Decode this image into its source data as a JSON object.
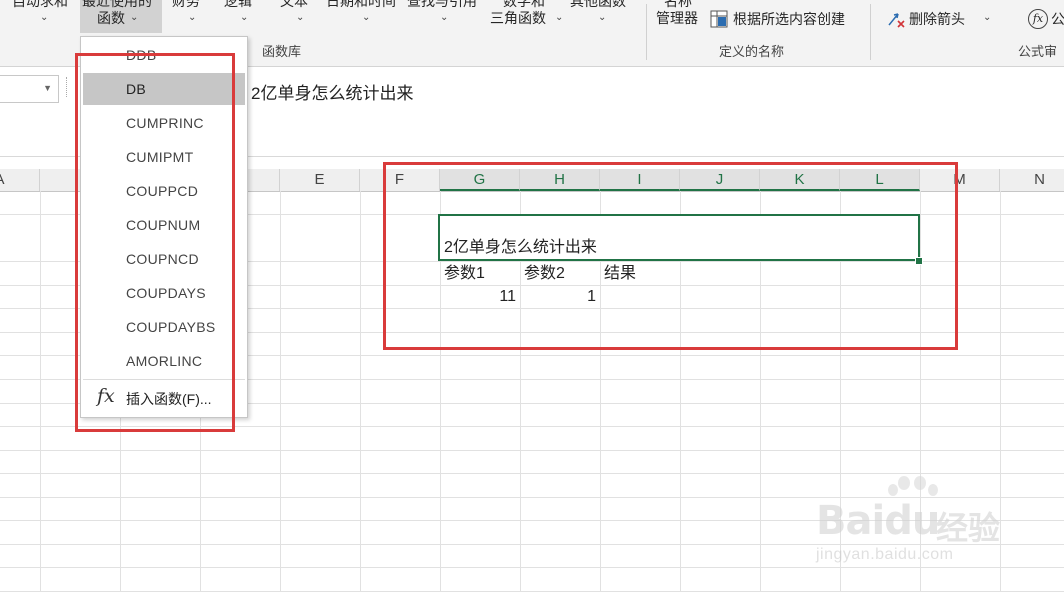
{
  "ribbon": {
    "btn_autosum": "自动求和",
    "btn_recent_line1": "最近使用的",
    "btn_recent_line2": "函数",
    "btn_financial": "财务",
    "btn_logical": "逻辑",
    "btn_text": "文本",
    "btn_datetime": "日期和时间",
    "btn_lookup": "查找与引用",
    "btn_math_line1": "数学和",
    "btn_math_line2": "三角函数",
    "btn_more": "其他函数",
    "btn_name_manager_line1": "名称",
    "btn_name_manager_line2": "管理器",
    "btn_create_from_selection": "根据所选内容创建",
    "btn_remove_arrows": "删除箭头",
    "btn_formula_trunc": "公",
    "group_function_library": "函数库",
    "group_defined_names": "定义的名称",
    "group_formula_auditing": "公式审"
  },
  "formula_bar": {
    "content": "2亿单身怎么统计出来"
  },
  "columns": [
    "A",
    "E",
    "F",
    "G",
    "H",
    "I",
    "J",
    "K",
    "L",
    "M",
    "N"
  ],
  "sheet": {
    "merged_text": "2亿单身怎么统计出来",
    "header_param1": "参数1",
    "header_param2": "参数2",
    "header_result": "结果",
    "value_param1": "11",
    "value_param2": "1"
  },
  "menu": {
    "items": [
      {
        "label": "DDB"
      },
      {
        "label": "DB"
      },
      {
        "label": "CUMPRINC"
      },
      {
        "label": "CUMIPMT"
      },
      {
        "label": "COUPPCD"
      },
      {
        "label": "COUPNUM"
      },
      {
        "label": "COUPNCD"
      },
      {
        "label": "COUPDAYS"
      },
      {
        "label": "COUPDAYBS"
      },
      {
        "label": "AMORLINC"
      }
    ],
    "fx_symbol": "fx",
    "insert_function": "插入函数(F)..."
  },
  "watermark": {
    "brand": "Bai",
    "brand2": "du",
    "cn": "经验",
    "url": "jingyan.baidu.com"
  },
  "colors": {
    "excel_green": "#217346",
    "annotation_red": "#d93b3b",
    "menu_selected": "#c6c6c6"
  }
}
